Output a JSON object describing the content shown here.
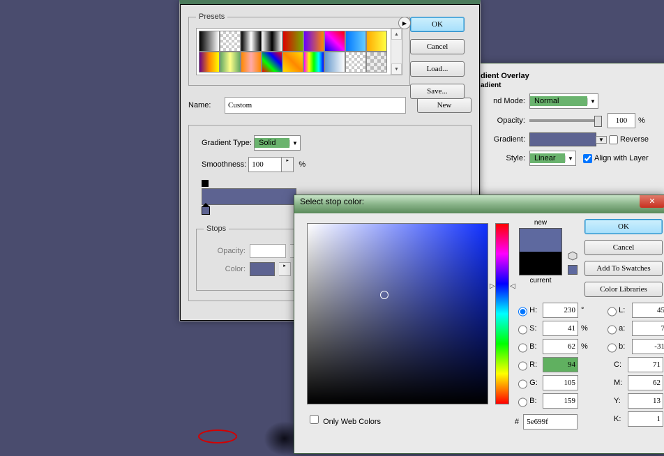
{
  "gradEditor": {
    "presetsLegend": "Presets",
    "ok": "OK",
    "cancel": "Cancel",
    "load": "Load...",
    "save": "Save...",
    "nameLabel": "Name:",
    "nameValue": "Custom",
    "newBtn": "New",
    "typeLabel": "Gradient Type:",
    "typeValue": "Solid",
    "smoothLabel": "Smoothness:",
    "smoothValue": "100",
    "percent": "%",
    "stopsLegend": "Stops",
    "opacityLabel": "Opacity:",
    "colorLabel": "Color:"
  },
  "overlay": {
    "title": "dient Overlay",
    "sub": "adient",
    "blendLabel": "nd Mode:",
    "blendValue": "Normal",
    "opLabel": "Opacity:",
    "opValue": "100",
    "pct": "%",
    "gradLabel": "Gradient:",
    "reverse": "Reverse",
    "styleLabel": "Style:",
    "styleValue": "Linear",
    "align": "Align with Layer"
  },
  "picker": {
    "title": "Select stop color:",
    "newLabel": "new",
    "curLabel": "current",
    "ok": "OK",
    "cancel": "Cancel",
    "addSw": "Add To Swatches",
    "colorLib": "Color Libraries",
    "H": "230",
    "Hdeg": "°",
    "S": "41",
    "B": "62",
    "R": "94",
    "G": "105",
    "Bl": "159",
    "L": "45",
    "a": "7",
    "b2": "-31",
    "C": "71",
    "M": "62",
    "Y": "13",
    "K": "1",
    "hex": "5e699f",
    "web": "Only Web Colors"
  },
  "swatchGradients": [
    [
      "linear-gradient(to right,#000,#fff)",
      "repeating-conic-gradient(#ccc 0 25%,#fff 0 50%) 0 0/8px 8px",
      "linear-gradient(to right,#000,#fff,#000)",
      "linear-gradient(to right,#fff,#000,#fff)",
      "linear-gradient(to right,#d00,#7a0)",
      "linear-gradient(to right,#60f,#f80)",
      "linear-gradient(45deg,#00f,#f0f,#f00)",
      "linear-gradient(to right,#07f,#6cf)",
      "linear-gradient(to right,#fa0,#ff4)"
    ],
    [
      "linear-gradient(to right,#608,#f80,#ff0)",
      "linear-gradient(to right,#6a6,#ff8,#6a6)",
      "linear-gradient(to right,#f80,#faa,#f80)",
      "linear-gradient(45deg,#f00,#0f0,#00f,#f00)",
      "linear-gradient(45deg,#fd0,#f80,#fd0)",
      "linear-gradient(to right,#f0f,#ff0,#0f0,#0ff,#00f)",
      "linear-gradient(to right,#69c,#fff)",
      "repeating-conic-gradient(#ccc 0 25%,#fff 0 50%) 0 0/8px 8px",
      "repeating-conic-gradient(#bbb 0 25%,#eee 0 50%) 0 0/10px 10px"
    ]
  ]
}
